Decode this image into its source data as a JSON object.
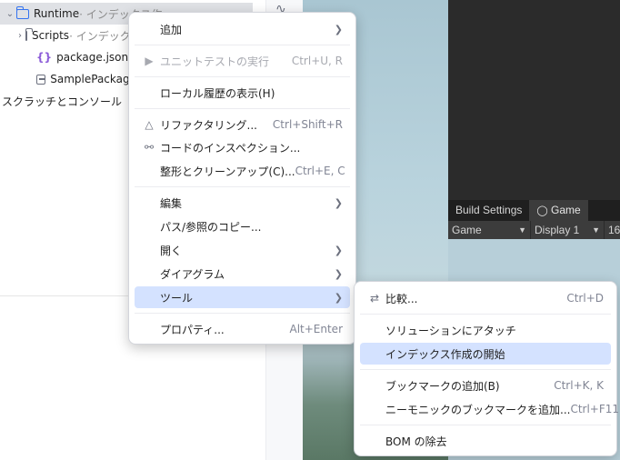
{
  "tree": {
    "runtime": {
      "name": "Runtime",
      "sub": " · インデックス作"
    },
    "scripts": {
      "name": "Scripts",
      "sub": " · インデックス"
    },
    "package": {
      "name": "package.json",
      "sub": " · イ"
    },
    "sample": {
      "name": "SamplePackage",
      "sub": ""
    },
    "scratch": {
      "name": "スクラッチとコンソール"
    }
  },
  "unity": {
    "tab_build": "Build Settings",
    "tab_game": "Game",
    "dropdown_game": "Game",
    "dropdown_display": "Display 1",
    "dropdown_res": "16"
  },
  "context_menu": {
    "add": "追加",
    "run_tests": "ユニットテストの実行",
    "run_tests_sc": "Ctrl+U, R",
    "local_history": "ローカル履歴の表示(H)",
    "refactoring": "リファクタリング...",
    "refactoring_sc": "Ctrl+Shift+R",
    "inspection": "コードのインスペクション...",
    "cleanup": "整形とクリーンアップ(C)...",
    "cleanup_sc": "Ctrl+E, C",
    "edit": "編集",
    "copy_path": "パス/参照のコピー...",
    "open": "開く",
    "diagram": "ダイアグラム",
    "tools": "ツール",
    "properties": "プロパティ...",
    "properties_sc": "Alt+Enter"
  },
  "tools_menu": {
    "compare": "比較...",
    "compare_sc": "Ctrl+D",
    "attach": "ソリューションにアタッチ",
    "start_indexing": "インデックス作成の開始",
    "add_bookmark": "ブックマークの追加(B)",
    "add_bookmark_sc": "Ctrl+K, K",
    "add_mnemonic": "ニーモニックのブックマークを追加...",
    "add_mnemonic_sc": "Ctrl+F11",
    "remove_bom": "BOM の除去"
  },
  "icons": {
    "submenu": "chevron-right-icon",
    "play": "play-icon",
    "refactor": "refactor-triangle-icon",
    "inspect": "inspection-bug-icon",
    "compare": "compare-arrows-icon",
    "gamepad": "gamepad-icon"
  },
  "colors": {
    "highlight": "#d4e2ff",
    "selection_row": "#dfe1e5",
    "unity_dark": "#2b2b2b"
  }
}
